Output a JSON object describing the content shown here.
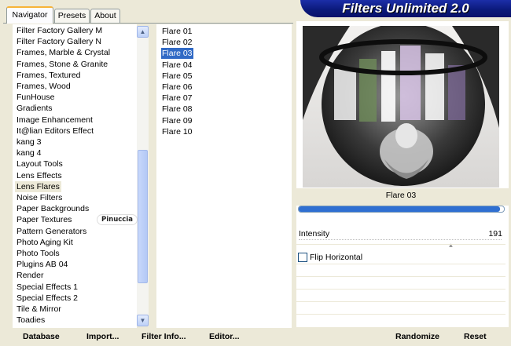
{
  "window": {
    "title": "Filters Unlimited 2.0"
  },
  "tabs": [
    {
      "label": "Navigator",
      "active": true
    },
    {
      "label": "Presets",
      "active": false
    },
    {
      "label": "About",
      "active": false
    }
  ],
  "categories": [
    "Filter Factory Gallery M",
    "Filter Factory Gallery N",
    "Frames, Marble & Crystal",
    "Frames, Stone & Granite",
    "Frames, Textured",
    "Frames, Wood",
    "FunHouse",
    "Gradients",
    "Image Enhancement",
    "It@lian Editors Effect",
    "kang 3",
    "kang 4",
    "Layout Tools",
    "Lens Effects",
    "Lens Flares",
    "Noise Filters",
    "Paper Backgrounds",
    "Paper Textures",
    "Pattern Generators",
    "Photo Aging Kit",
    "Photo Tools",
    "Plugins AB 04",
    "Render",
    "Special Effects 1",
    "Special Effects 2",
    "Tile & Mirror",
    "Toadies"
  ],
  "selected_category": "Lens Flares",
  "filters": [
    "Flare 01",
    "Flare 02",
    "Flare 03",
    "Flare 04",
    "Flare 05",
    "Flare 06",
    "Flare 07",
    "Flare 08",
    "Flare 09",
    "Flare 10"
  ],
  "selected_filter": "Flare 03",
  "preview": {
    "name": "Flare 03",
    "progress": 0.98
  },
  "controls": {
    "intensity_label": "Intensity",
    "intensity_value": "191",
    "intensity_fraction": 0.75,
    "flip_label": "Flip Horizontal",
    "flip_checked": false
  },
  "buttons": {
    "database": "Database",
    "import": "Import...",
    "filter_info": "Filter Info...",
    "editor": "Editor...",
    "randomize": "Randomize",
    "reset": "Reset"
  },
  "watermark": "Pinuccia",
  "colors": {
    "selection": "#316ac5",
    "banner": "#0a1878",
    "tab_highlight": "#f7b338"
  }
}
